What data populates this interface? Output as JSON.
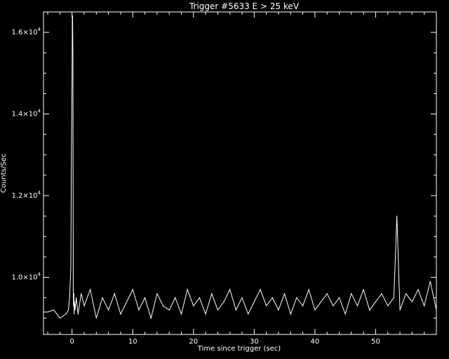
{
  "chart_data": {
    "type": "line",
    "title": "Trigger #5633 E > 25 keV",
    "xlabel": "Time since trigger (sec)",
    "ylabel": "Counts/Sec",
    "xlim": [
      -4.7,
      60
    ],
    "ylim": [
      8600,
      16500
    ],
    "x_ticks": [
      {
        "value": 0,
        "label": "0"
      },
      {
        "value": 10,
        "label": "10"
      },
      {
        "value": 20,
        "label": "20"
      },
      {
        "value": 30,
        "label": "30"
      },
      {
        "value": 40,
        "label": "40"
      },
      {
        "value": 50,
        "label": "50"
      }
    ],
    "y_ticks": [
      {
        "value": 10000,
        "mantissa": "1.0×10",
        "exponent": "4"
      },
      {
        "value": 12000,
        "mantissa": "1.2×10",
        "exponent": "4"
      },
      {
        "value": 14000,
        "mantissa": "1.4×10",
        "exponent": "4"
      },
      {
        "value": 16000,
        "mantissa": "1.6×10",
        "exponent": "4"
      }
    ],
    "grid": false,
    "style": {
      "background": "#000000",
      "foreground": "#ffffff"
    },
    "series": [
      {
        "x": [
          -4.7,
          -4.0,
          -3.0,
          -2.0,
          -1.0,
          -0.6,
          -0.4,
          -0.2,
          -0.1,
          0.0,
          0.05,
          0.1,
          0.15,
          0.2,
          0.25,
          0.3,
          0.35,
          0.4,
          0.5,
          0.7,
          1.0,
          1.5,
          2.0,
          3.0,
          4.0,
          5.0,
          6.0,
          7.0,
          8.0,
          9.0,
          10.0,
          11.0,
          12.0,
          13.0,
          14.0,
          15.0,
          16.0,
          17.0,
          18.0,
          19.0,
          20.0,
          21.0,
          22.0,
          23.0,
          24.0,
          25.0,
          26.0,
          27.0,
          28.0,
          29.0,
          30.0,
          31.0,
          32.0,
          33.0,
          34.0,
          35.0,
          36.0,
          37.0,
          38.0,
          39.0,
          40.0,
          41.0,
          42.0,
          43.0,
          44.0,
          45.0,
          46.0,
          47.0,
          48.0,
          49.0,
          50.0,
          51.0,
          52.0,
          53.0,
          53.5,
          54.0,
          55.0,
          56.0,
          57.0,
          58.0,
          59.0,
          60.0
        ],
        "y": [
          9150,
          9150,
          9200,
          9000,
          9100,
          9200,
          9500,
          10200,
          13000,
          14900,
          16400,
          16400,
          15300,
          9700,
          9300,
          9600,
          9100,
          9400,
          9200,
          9500,
          9100,
          9600,
          9300,
          9700,
          9000,
          9500,
          9200,
          9600,
          9100,
          9400,
          9700,
          9200,
          9500,
          9000,
          9600,
          9300,
          9200,
          9500,
          9100,
          9700,
          9300,
          9500,
          9100,
          9600,
          9200,
          9400,
          9700,
          9200,
          9500,
          9100,
          9400,
          9700,
          9300,
          9500,
          9200,
          9600,
          9100,
          9500,
          9300,
          9700,
          9200,
          9400,
          9600,
          9300,
          9500,
          9100,
          9600,
          9300,
          9700,
          9200,
          9400,
          9600,
          9300,
          9500,
          11500,
          9200,
          9600,
          9400,
          9700,
          9300,
          9900,
          9200
        ]
      }
    ]
  }
}
